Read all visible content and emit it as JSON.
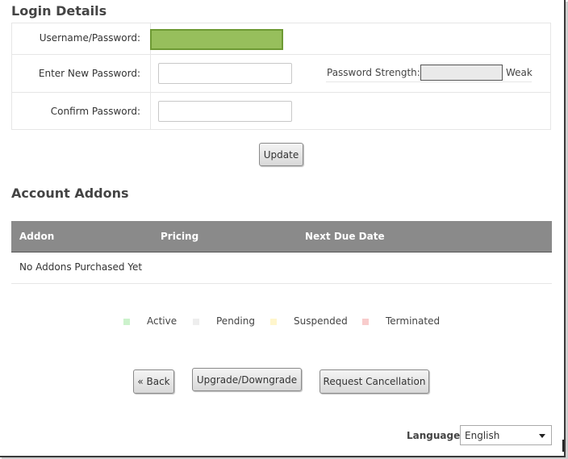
{
  "login": {
    "heading": "Login Details",
    "username_label": "Username/Password:",
    "new_password_label": "Enter New Password:",
    "confirm_password_label": "Confirm Password:",
    "strength_label": "Password Strength:",
    "strength_value": "Weak",
    "update_label": "Update"
  },
  "addons": {
    "heading": "Account Addons",
    "columns": [
      "Addon",
      "Pricing",
      "Next Due Date"
    ],
    "empty_text": "No Addons Purchased Yet"
  },
  "legend": [
    {
      "label": "Active",
      "color": "#ccf2cc"
    },
    {
      "label": "Pending",
      "color": "#eeeeee"
    },
    {
      "label": "Suspended",
      "color": "#fff6cc"
    },
    {
      "label": "Terminated",
      "color": "#f8cccc"
    }
  ],
  "actions": {
    "back_label": "« Back",
    "upgrade_label": "Upgrade/Downgrade",
    "cancel_label": "Request Cancellation"
  },
  "language": {
    "label": "Language:",
    "selected": "English"
  }
}
